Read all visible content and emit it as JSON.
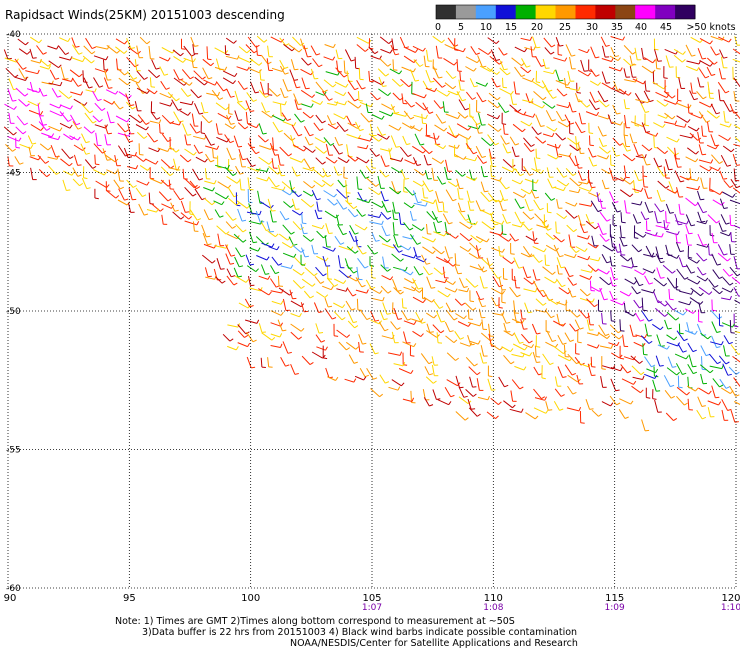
{
  "title": "Rapidsact Winds(25KM) 20151003 descending",
  "legend": {
    "ticks": [
      "0",
      "5",
      "10",
      "15",
      "20",
      "25",
      "30",
      "35",
      "40",
      "45",
      ">50 knots"
    ],
    "colors": [
      "#303030",
      "#9a9a9a",
      "#4aa0ff",
      "#1010d8",
      "#00b000",
      "#ffd700",
      "#ff9900",
      "#ff2a00",
      "#c00000",
      "#8b4513",
      "#ff00ff",
      "#8000c0",
      "#300060"
    ]
  },
  "lat_labels": [
    "-40",
    "-45",
    "-50",
    "-55",
    "-60"
  ],
  "lon_labels": [
    "90",
    "95",
    "100",
    "105",
    "110",
    "115",
    "120"
  ],
  "time_labels": [
    "1:07",
    "1:08",
    "1:09",
    "1:10"
  ],
  "notes": {
    "line1": "Note: 1) Times are GMT 2)Times along bottom correspond to measurement at ~50S",
    "line2": "3)Data buffer is 22 hrs from 20151003 4) Black wind barbs indicate possible contamination",
    "line3": "NOAA/NESDIS/Center for Satellite Applications and Research"
  }
}
